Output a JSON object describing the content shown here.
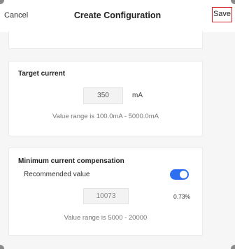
{
  "header": {
    "cancel_label": "Cancel",
    "title": "Create Configuration",
    "save_label": "Save"
  },
  "target_current": {
    "title": "Target current",
    "value": "350",
    "unit": "mA",
    "range_hint": "Value range is 100.0mA - 5000.0mA"
  },
  "min_current_comp": {
    "title": "Minimum current compensation",
    "recommended_label": "Recommended value",
    "toggle_on": true,
    "value": "10073",
    "percent": "0.73%",
    "range_hint": "Value range is 5000 - 20000"
  },
  "colors": {
    "accent": "#2d6ff2",
    "save_border": "#d3202a"
  }
}
